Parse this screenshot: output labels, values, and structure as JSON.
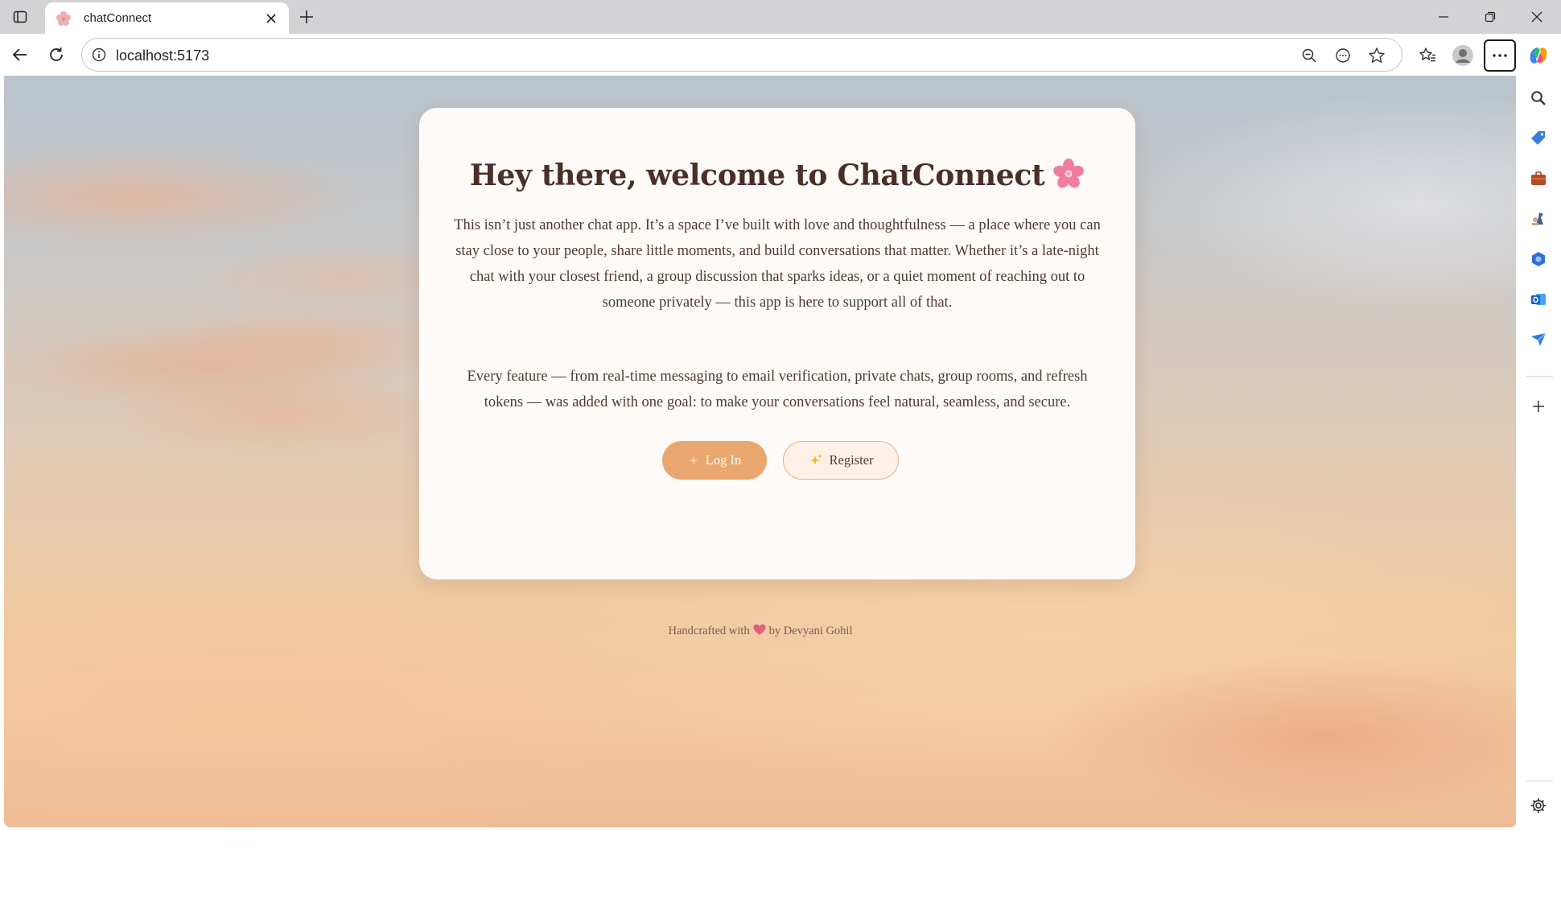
{
  "browser": {
    "tab_title": "chatConnect",
    "url": "localhost:5173"
  },
  "page": {
    "heading": "Hey there, welcome to ChatConnect",
    "paragraph1": "This isn’t just another chat app. It’s a space I’ve built with love and thoughtfulness — a place where you can stay close to your people, share little moments, and build conversations that matter. Whether it’s a late-night chat with your closest friend, a group discussion that sparks ideas, or a quiet moment of reaching out to someone privately — this app is here to support all of that.",
    "paragraph2": "Every feature — from real-time messaging to email verification, private chats, group rooms, and refresh tokens — was added with one goal: to make your conversations feel natural, seamless, and secure.",
    "login_label": "Log In",
    "register_label": "Register",
    "footer_prefix": "Handcrafted with",
    "footer_suffix": "by Devyani Gohil"
  },
  "colors": {
    "accent": "#e9a66e",
    "heading": "#4a2f27",
    "card_bg": "#fdfaf7"
  },
  "icons": {
    "tab_favicon": "flower-icon",
    "heading_emoji": "cherry-blossom-icon",
    "login_icon": "sparkle-icon",
    "register_icon": "sparkles-icon",
    "footer_icon": "heart-icon"
  }
}
